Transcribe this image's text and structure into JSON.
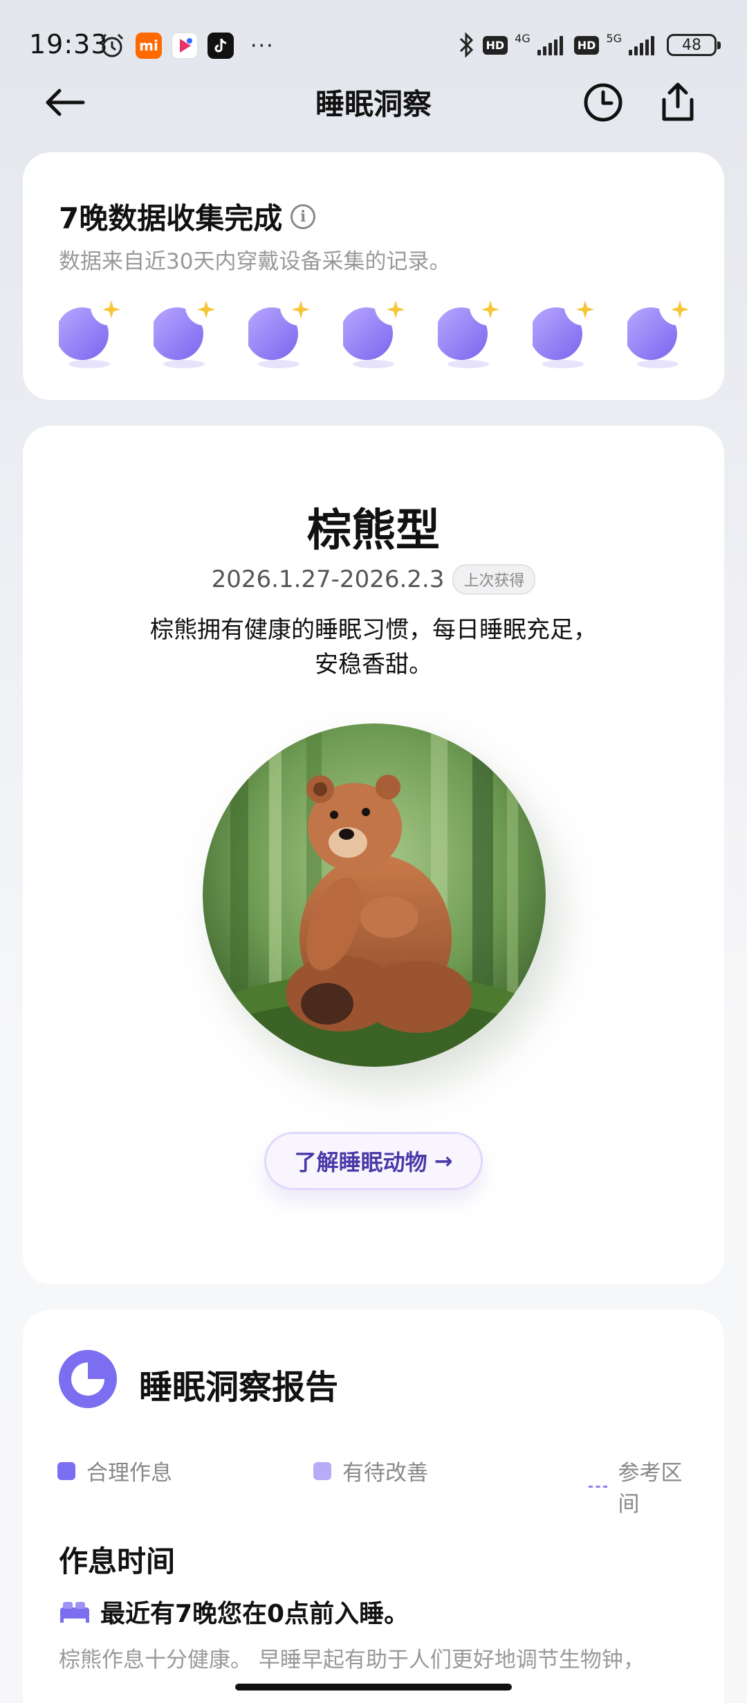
{
  "status_bar": {
    "time": "19:33",
    "more": "···",
    "net1": "4G",
    "net2": "5G",
    "hd": "HD",
    "battery": "48"
  },
  "nav": {
    "title": "睡眠洞察"
  },
  "collection": {
    "title": "7晚数据收集完成",
    "subtitle": "数据来自近30天内穿戴设备采集的记录。",
    "nights": 7
  },
  "animal": {
    "name": "棕熊型",
    "date_range": "2026.1.27-2026.2.3",
    "badge": "上次获得",
    "description": "棕熊拥有健康的睡眠习惯，每日睡眠充足，安稳香甜。",
    "learn_button": "了解睡眠动物",
    "learn_arrow": "→"
  },
  "report": {
    "title": "睡眠洞察报告",
    "legend": [
      {
        "label": "合理作息",
        "color": "#7b6ef0"
      },
      {
        "label": "有待改善",
        "color": "#b8acf6"
      },
      {
        "label": "参考区间",
        "color": "#8e7cf0"
      }
    ],
    "section_title": "作息时间",
    "highlight": "最近有7晚您在0点前入睡。",
    "body": "棕熊作息十分健康。 早睡早起有助于人们更好地调节生物钟，"
  },
  "colors": {
    "accent": "#7b6ef0",
    "moon": "#8f7cf4",
    "star": "#f6c637"
  }
}
